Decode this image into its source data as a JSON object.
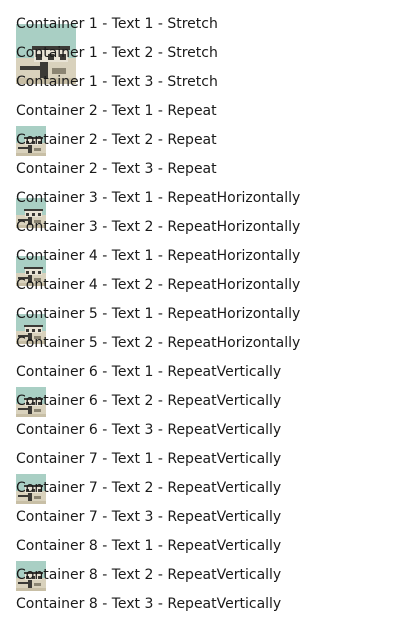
{
  "containers": [
    {
      "name": "Container 1",
      "mode": "Stretch",
      "lines": [
        "Container 1 - Text 1 - Stretch",
        "Container 1 - Text 2 - Stretch",
        "Container 1 - Text 3 - Stretch"
      ]
    },
    {
      "name": "Container 2",
      "mode": "Repeat",
      "lines": [
        "Container 2 - Text 1 - Repeat",
        "Container 2 - Text 2 - Repeat",
        "Container 2 - Text 3 - Repeat"
      ]
    },
    {
      "name": "Container 3",
      "mode": "RepeatHorizontally",
      "lines": [
        "Container 3 - Text 1 - RepeatHorizontally",
        "Container 3 - Text 2 - RepeatHorizontally"
      ]
    },
    {
      "name": "Container 4",
      "mode": "RepeatHorizontally",
      "lines": [
        "Container 4 - Text 1 - RepeatHorizontally",
        "Container 4 - Text 2 - RepeatHorizontally"
      ]
    },
    {
      "name": "Container 5",
      "mode": "RepeatHorizontally",
      "lines": [
        "Container 5 - Text 1 - RepeatHorizontally",
        "Container 5 - Text 2 - RepeatHorizontally"
      ]
    },
    {
      "name": "Container 6",
      "mode": "RepeatVertically",
      "lines": [
        "Container 6 - Text 1 - RepeatVertically",
        "Container 6 - Text 2 - RepeatVertically",
        "Container 6 - Text 3 - RepeatVertically"
      ]
    },
    {
      "name": "Container 7",
      "mode": "RepeatVertically",
      "lines": [
        "Container 7 - Text 1 - RepeatVertically",
        "Container 7 - Text 2 - RepeatVertically",
        "Container 7 - Text 3 - RepeatVertically"
      ]
    },
    {
      "name": "Container 8",
      "mode": "RepeatVertically",
      "lines": [
        "Container 8 - Text 1 - RepeatVertically",
        "Container 8 - Text 2 - RepeatVertically",
        "Container 8 - Text 3 - RepeatVertically"
      ]
    }
  ],
  "background_image": {
    "icon": "landscape-background-image",
    "colors": {
      "sky": "#a9cfc4",
      "ground": "#d9d2bd",
      "structure": "#3b3a36",
      "highlight": "#e9e4d6"
    }
  }
}
